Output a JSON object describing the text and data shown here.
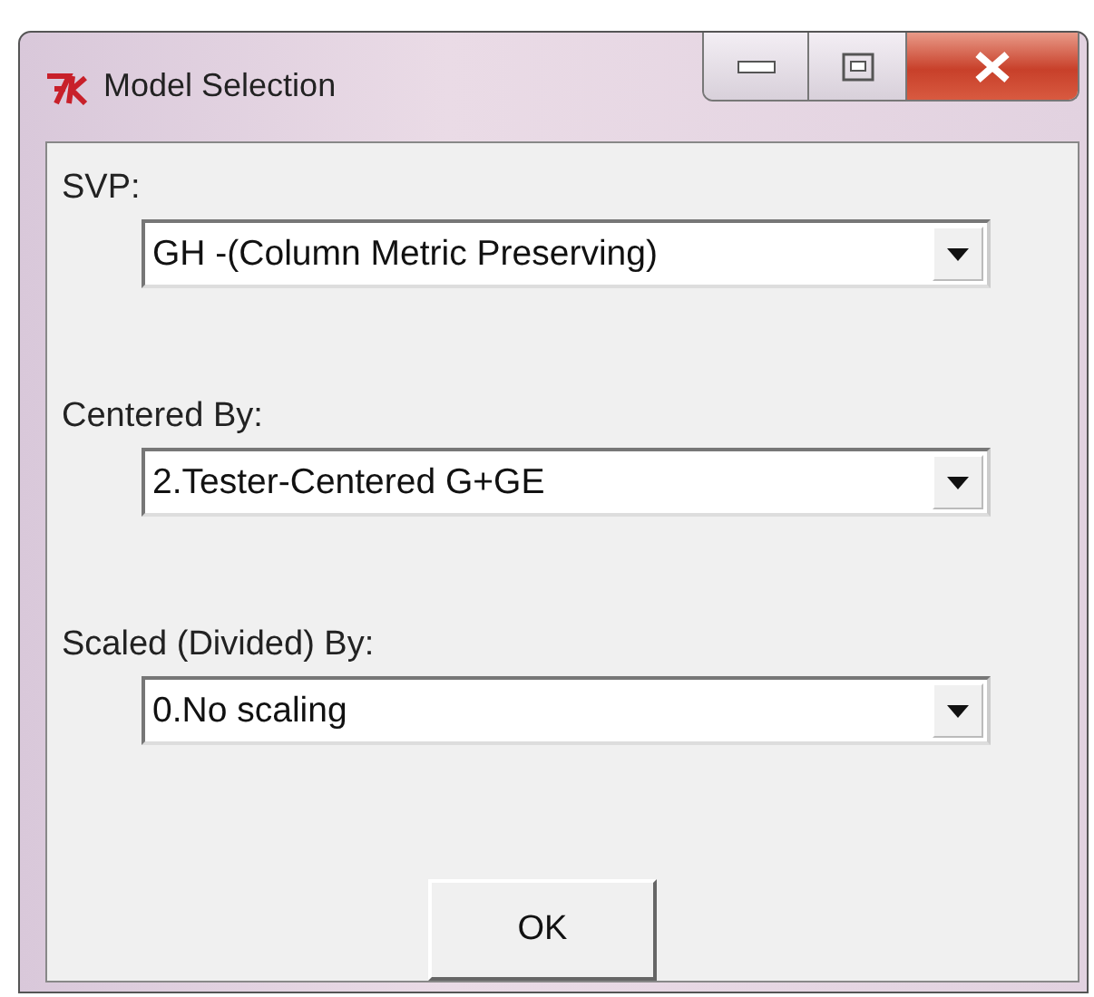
{
  "window": {
    "title": "Model Selection"
  },
  "fields": [
    {
      "label": "SVP:",
      "value": "GH -(Column Metric Preserving)"
    },
    {
      "label": "Centered By:",
      "value": "2.Tester-Centered G+GE"
    },
    {
      "label": "Scaled (Divided) By:",
      "value": "0.No scaling"
    }
  ],
  "buttons": [
    {
      "label": "OK"
    }
  ]
}
